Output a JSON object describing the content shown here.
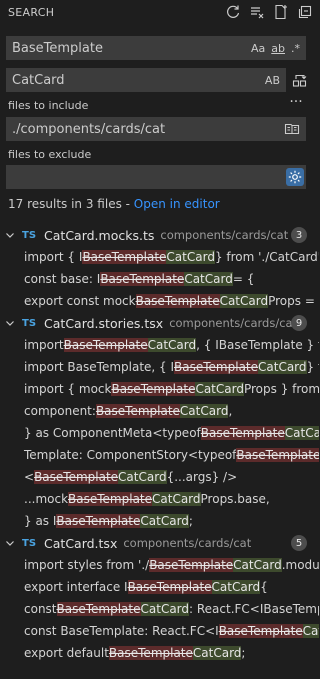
{
  "header": {
    "title": "SEARCH"
  },
  "search": {
    "value": "BaseTemplate",
    "opt_case": "Aa",
    "opt_word": "ab",
    "opt_regex": ".*"
  },
  "replace": {
    "value": "CatCard",
    "opt_preserve": "AB"
  },
  "include": {
    "label": "files to include",
    "value": "./components/cards/cat"
  },
  "exclude": {
    "label": "files to exclude",
    "value": ""
  },
  "summary": {
    "text": "17 results in 3 files - ",
    "link": "Open in editor"
  },
  "files": [
    {
      "name": "CatCard.mocks.ts",
      "path": "components/cards/cat",
      "count": "3",
      "lines": [
        [
          {
            "t": "import { I"
          },
          {
            "t": "BaseTemplate",
            "s": "del"
          },
          {
            "t": "CatCard",
            "s": "ins"
          },
          {
            "t": " } from './CatCard';"
          }
        ],
        [
          {
            "t": "const base: I"
          },
          {
            "t": "BaseTemplate",
            "s": "del"
          },
          {
            "t": "CatCard",
            "s": "ins"
          },
          {
            "t": " = {"
          }
        ],
        [
          {
            "t": "export const mock"
          },
          {
            "t": "BaseTemplate",
            "s": "del"
          },
          {
            "t": "CatCard",
            "s": "ins"
          },
          {
            "t": "Props = {"
          }
        ]
      ]
    },
    {
      "name": "CatCard.stories.tsx",
      "path": "components/cards/cat",
      "count": "9",
      "lines": [
        [
          {
            "t": "import "
          },
          {
            "t": "BaseTemplate",
            "s": "del"
          },
          {
            "t": "CatCard",
            "s": "ins"
          },
          {
            "t": ", { IBaseTemplate } fr..."
          }
        ],
        [
          {
            "t": "import BaseTemplate, { I"
          },
          {
            "t": "BaseTemplate",
            "s": "del"
          },
          {
            "t": "CatCard",
            "s": "ins"
          },
          {
            "t": " } fr..."
          }
        ],
        [
          {
            "t": "import { mock"
          },
          {
            "t": "BaseTemplate",
            "s": "del"
          },
          {
            "t": "CatCard",
            "s": "ins"
          },
          {
            "t": "Props } from '..."
          }
        ],
        [
          {
            "t": "component: "
          },
          {
            "t": "BaseTemplate",
            "s": "del"
          },
          {
            "t": "CatCard",
            "s": "ins"
          },
          {
            "t": ","
          }
        ],
        [
          {
            "t": "} as ComponentMeta<typeof "
          },
          {
            "t": "BaseTemplate",
            "s": "del"
          },
          {
            "t": "CatCa...",
            "s": "ins"
          }
        ],
        [
          {
            "t": "Template: ComponentStory<typeof "
          },
          {
            "t": "BaseTemplate...",
            "s": "del"
          }
        ],
        [
          {
            "t": "<"
          },
          {
            "t": "BaseTemplate",
            "s": "del"
          },
          {
            "t": "CatCard",
            "s": "ins"
          },
          {
            "t": " {...args} />"
          }
        ],
        [
          {
            "t": "...mock"
          },
          {
            "t": "BaseTemplate",
            "s": "del"
          },
          {
            "t": "CatCard",
            "s": "ins"
          },
          {
            "t": "Props.base,"
          }
        ],
        [
          {
            "t": "} as I"
          },
          {
            "t": "BaseTemplate",
            "s": "del"
          },
          {
            "t": "CatCard",
            "s": "ins"
          },
          {
            "t": ";"
          }
        ]
      ]
    },
    {
      "name": "CatCard.tsx",
      "path": "components/cards/cat",
      "count": "5",
      "lines": [
        [
          {
            "t": "import styles from './"
          },
          {
            "t": "BaseTemplate",
            "s": "del"
          },
          {
            "t": "CatCard",
            "s": "ins"
          },
          {
            "t": ".modul..."
          }
        ],
        [
          {
            "t": "export interface I"
          },
          {
            "t": "BaseTemplate",
            "s": "del"
          },
          {
            "t": "CatCard",
            "s": "ins"
          },
          {
            "t": " {"
          }
        ],
        [
          {
            "t": "const "
          },
          {
            "t": "BaseTemplate",
            "s": "del"
          },
          {
            "t": "CatCard",
            "s": "ins"
          },
          {
            "t": ": React.FC<IBaseTemp..."
          }
        ],
        [
          {
            "t": "const BaseTemplate: React.FC<I"
          },
          {
            "t": "BaseTemplate",
            "s": "del"
          },
          {
            "t": "Cat...",
            "s": "ins"
          }
        ],
        [
          {
            "t": "export default "
          },
          {
            "t": "BaseTemplate",
            "s": "del"
          },
          {
            "t": "CatCard",
            "s": "ins"
          },
          {
            "t": ";"
          }
        ]
      ]
    }
  ]
}
